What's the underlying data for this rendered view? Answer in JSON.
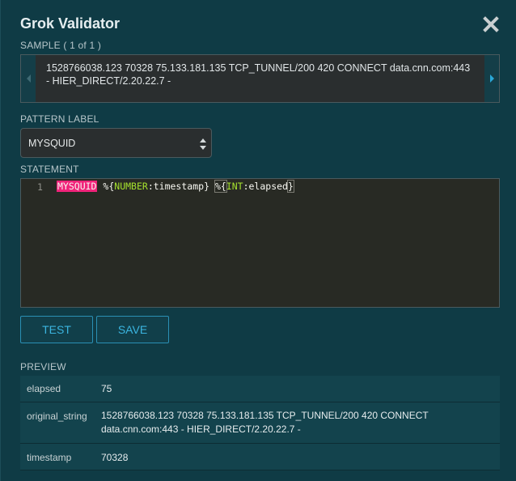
{
  "dialog": {
    "title": "Grok Validator",
    "close_icon": "close-icon"
  },
  "sample": {
    "label": "SAMPLE ( 1 of 1 )",
    "text": "1528766038.123  70328 75.133.181.135 TCP_TUNNEL/200 420 CONNECT data.cnn.com:443 - HIER_DIRECT/2.20.22.7 -",
    "prev_icon": "chevron-left-icon",
    "next_icon": "chevron-right-icon"
  },
  "pattern": {
    "label": "PATTERN LABEL",
    "selected": "MYSQUID"
  },
  "statement": {
    "label": "STATEMENT",
    "line_number": "1",
    "tokens": {
      "pattern_name": "MYSQUID",
      "open1": "%{",
      "kw1": "NUMBER",
      "field1": ":timestamp",
      "close1": "}",
      "open2": "%{",
      "kw2": "INT",
      "field2": ":elapsed",
      "close2": "}"
    }
  },
  "buttons": {
    "test": "TEST",
    "save": "SAVE"
  },
  "preview": {
    "label": "PREVIEW",
    "rows": [
      {
        "key": "elapsed",
        "value": "75"
      },
      {
        "key": "original_string",
        "value": "1528766038.123 70328 75.133.181.135 TCP_TUNNEL/200 420 CONNECT data.cnn.com:443 - HIER_DIRECT/2.20.22.7 -"
      },
      {
        "key": "timestamp",
        "value": "70328"
      }
    ]
  },
  "colors": {
    "background": "#0f3b45",
    "accent": "#2aa8d8",
    "pattern_highlight": "#f0237a",
    "keyword_green": "#a6e22e"
  }
}
